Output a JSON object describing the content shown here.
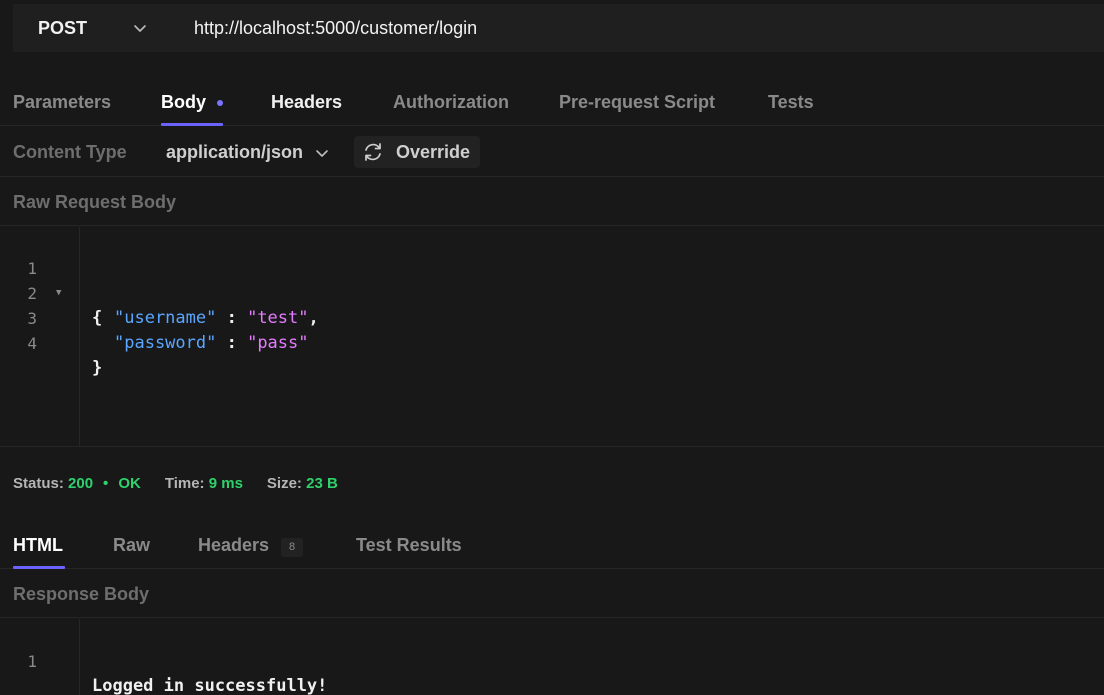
{
  "request": {
    "method": "POST",
    "url": "http://localhost:5000/customer/login"
  },
  "request_tabs": [
    {
      "label": "Parameters"
    },
    {
      "label": "Body"
    },
    {
      "label": "Headers"
    },
    {
      "label": "Authorization"
    },
    {
      "label": "Pre-request Script"
    },
    {
      "label": "Tests"
    }
  ],
  "content_type": {
    "label": "Content Type",
    "value": "application/json",
    "override_label": "Override"
  },
  "request_body": {
    "title": "Raw Request Body",
    "line_numbers": [
      "1",
      "2",
      "3",
      "4"
    ],
    "lines": {
      "open": "{",
      "key1": "\"username\"",
      "val1": "\"test\"",
      "key2": "\"password\"",
      "val2": "\"pass\"",
      "close": "}",
      "colon": " : ",
      "comma": ","
    }
  },
  "status": {
    "status_label": "Status:",
    "code": "200",
    "text": "OK",
    "time_label": "Time:",
    "time_value": "9 ms",
    "size_label": "Size:",
    "size_value": "23 B"
  },
  "response_tabs": [
    {
      "label": "HTML"
    },
    {
      "label": "Raw"
    },
    {
      "label": "Headers",
      "badge": "8"
    },
    {
      "label": "Test Results"
    }
  ],
  "response_body": {
    "title": "Response Body",
    "line_numbers": [
      "1"
    ],
    "content": "Logged in successfully!"
  },
  "colors": {
    "accent": "#6c63ff",
    "success": "#2ed16b",
    "json_key": "#5aa6ff",
    "json_string": "#e57bff"
  }
}
